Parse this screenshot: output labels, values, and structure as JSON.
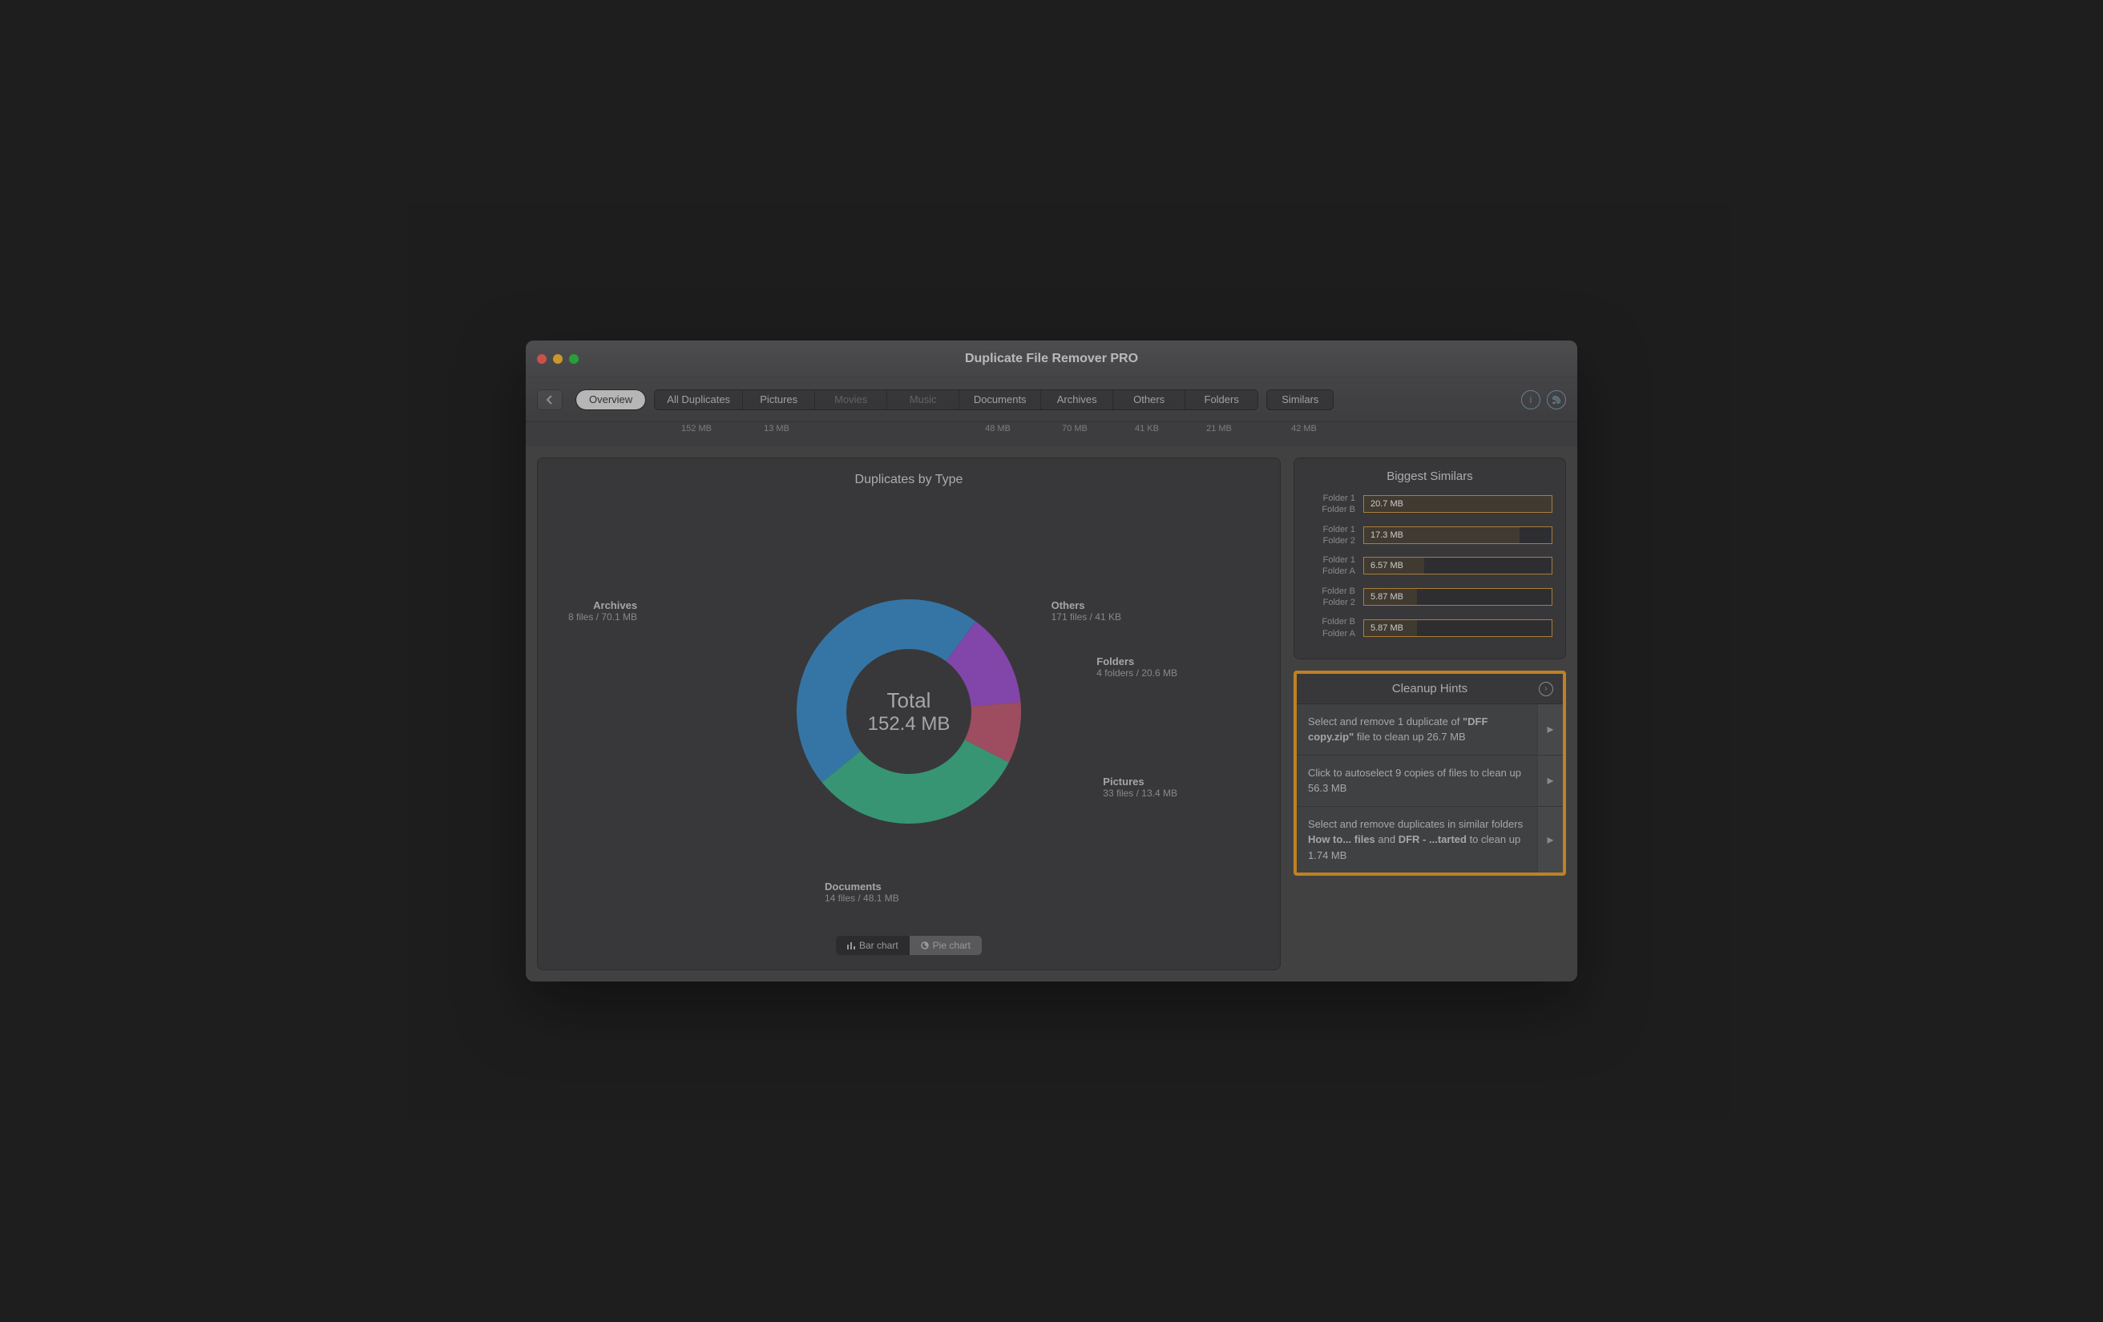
{
  "app": {
    "title": "Duplicate File Remover PRO"
  },
  "tabs": {
    "overview": "Overview",
    "list": [
      {
        "label": "All Duplicates",
        "size": "152 MB",
        "disabled": false
      },
      {
        "label": "Pictures",
        "size": "13 MB",
        "disabled": false
      },
      {
        "label": "Movies",
        "size": "",
        "disabled": true
      },
      {
        "label": "Music",
        "size": "",
        "disabled": true
      },
      {
        "label": "Documents",
        "size": "48 MB",
        "disabled": false
      },
      {
        "label": "Archives",
        "size": "70 MB",
        "disabled": false
      },
      {
        "label": "Others",
        "size": "41 KB",
        "disabled": false
      },
      {
        "label": "Folders",
        "size": "21 MB",
        "disabled": false
      }
    ],
    "similars": {
      "label": "Similars",
      "size": "42 MB"
    }
  },
  "chart": {
    "title": "Duplicates by Type",
    "center_label": "Total",
    "center_value": "152.4 MB",
    "callouts": {
      "archives": {
        "name": "Archives",
        "detail": "8 files / 70.1 MB"
      },
      "others": {
        "name": "Others",
        "detail": "171 files / 41 KB"
      },
      "folders": {
        "name": "Folders",
        "detail": "4 folders / 20.6 MB"
      },
      "pictures": {
        "name": "Pictures",
        "detail": "33 files / 13.4 MB"
      },
      "documents": {
        "name": "Documents",
        "detail": "14 files / 48.1 MB"
      }
    },
    "toggle": {
      "bar": "Bar chart",
      "pie": "Pie chart"
    }
  },
  "chart_data": {
    "type": "pie",
    "title": "Duplicates by Type",
    "categories": [
      "Archives",
      "Documents",
      "Pictures",
      "Folders",
      "Others"
    ],
    "values_mb": [
      70.1,
      48.1,
      13.4,
      20.6,
      0.041
    ],
    "counts": [
      8,
      14,
      33,
      4,
      171
    ],
    "total_label": "152.4 MB",
    "colors": [
      "#3a8fd0",
      "#3cba8d",
      "#c45a72",
      "#a14fd6",
      "#3a8fd0"
    ]
  },
  "similars_panel": {
    "title": "Biggest Similars",
    "rows": [
      {
        "a": "Folder 1",
        "b": "Folder B",
        "size": "20.7 MB",
        "pct": 100
      },
      {
        "a": "Folder 1",
        "b": "Folder 2",
        "size": "17.3 MB",
        "pct": 83
      },
      {
        "a": "Folder 1",
        "b": "Folder A",
        "size": "6.57 MB",
        "pct": 32
      },
      {
        "a": "Folder B",
        "b": "Folder 2",
        "size": "5.87 MB",
        "pct": 28
      },
      {
        "a": "Folder B",
        "b": "Folder A",
        "size": "5.87 MB",
        "pct": 28
      }
    ]
  },
  "hints": {
    "title": "Cleanup Hints",
    "items": [
      {
        "pre": "Select and remove 1 duplicate of ",
        "bold": "\"DFF copy.zip\"",
        "post": " file to clean up 26.7 MB"
      },
      {
        "pre": "Click to autoselect 9 copies of files to clean up 56.3 MB",
        "bold": "",
        "post": ""
      },
      {
        "pre": "Select and remove duplicates in similar folders ",
        "bold": "How to... files",
        "mid": " and ",
        "bold2": "DFR - ...tarted",
        "post": " to clean up 1.74 MB"
      }
    ]
  }
}
